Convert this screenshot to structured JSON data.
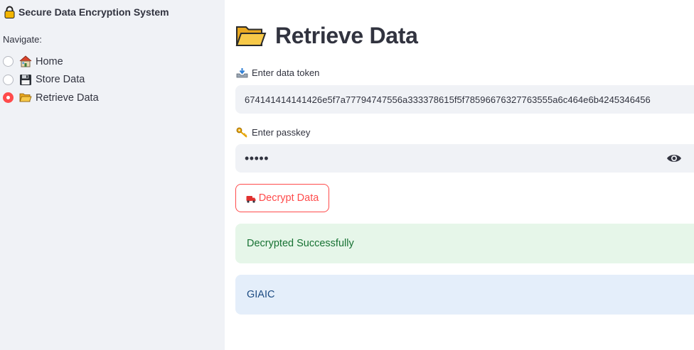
{
  "sidebar": {
    "title": "Secure Data Encryption System",
    "title_icon": "lock-icon",
    "nav_label": "Navigate:",
    "options": [
      {
        "label": "Home",
        "icon": "house-icon",
        "selected": false
      },
      {
        "label": "Store Data",
        "icon": "floppy-disk-icon",
        "selected": false
      },
      {
        "label": "Retrieve Data",
        "icon": "open-folder-icon",
        "selected": true
      }
    ]
  },
  "main": {
    "title": "Retrieve Data",
    "title_icon": "open-folder-icon",
    "token_field": {
      "label": "Enter data token",
      "icon": "inbox-tray-icon",
      "value": "674141414141426e5f7a77794747556a333378615f5f78596676327763555a6c464e6b4245346456"
    },
    "passkey_field": {
      "label": "Enter passkey",
      "icon": "key-icon",
      "value": "•••••",
      "toggle_icon": "eye-icon"
    },
    "decrypt_button": {
      "label": "Decrypt Data",
      "icon": "delivery-truck-icon"
    },
    "success_message": "Decrypted Successfully",
    "info_message": "GIAIC"
  },
  "colors": {
    "accent": "#ff4b4b",
    "sidebar_bg": "#f0f2f6",
    "success_bg": "#e6f6e9",
    "success_text": "#177233",
    "info_bg": "#e4eefa",
    "info_text": "#1c4b82"
  }
}
